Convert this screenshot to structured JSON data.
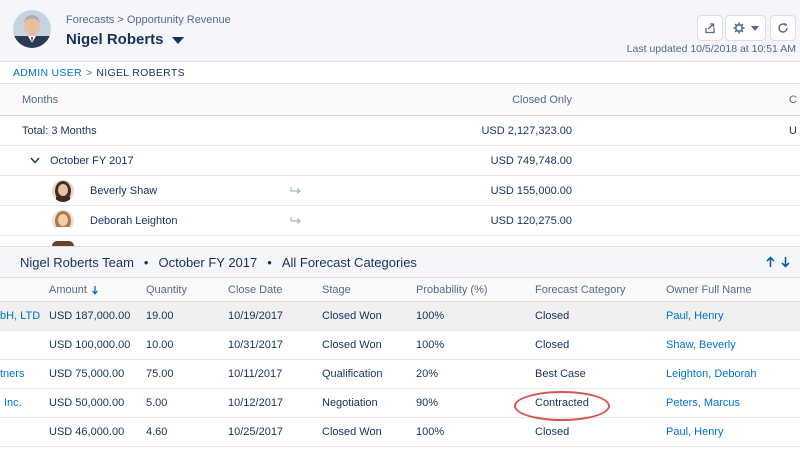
{
  "header": {
    "breadcrumb": "Forecasts > Opportunity Revenue",
    "owner_name": "Nigel Roberts",
    "last_updated": "Last updated 10/5/2018 at 10:51 AM",
    "share_icon": "share-icon",
    "gear_icon": "gear-icon",
    "refresh_icon": "refresh-icon"
  },
  "breadcrumb": {
    "parent": "ADMIN USER",
    "separator": ">",
    "current": "NIGEL ROBERTS"
  },
  "forecast_grid": {
    "columns": {
      "months": "Months",
      "closed_only": "Closed Only",
      "next_col_partial": "C"
    },
    "total_row": {
      "label": "Total: 3 Months",
      "closed_only": "USD 2,127,323.00",
      "next_col_partial": "U"
    },
    "period_row": {
      "label": "October FY 2017",
      "closed_only": "USD 749,748.00"
    },
    "reps": [
      {
        "name": "Beverly Shaw",
        "closed_only": "USD 155,000.00"
      },
      {
        "name": "Deborah Leighton",
        "closed_only": "USD 120,275.00"
      }
    ]
  },
  "panel": {
    "team": "Nigel Roberts Team",
    "period": "October FY 2017",
    "category": "All Forecast Categories",
    "separator": "•"
  },
  "opportunities": {
    "columns": {
      "amount": "Amount",
      "quantity": "Quantity",
      "close_date": "Close Date",
      "stage": "Stage",
      "probability": "Probability (%)",
      "forecast_category": "Forecast Category",
      "owner": "Owner Full Name"
    },
    "rows": [
      {
        "account": "bH, LTD",
        "amount": "USD 187,000.00",
        "quantity": "19.00",
        "close_date": "10/19/2017",
        "stage": "Closed Won",
        "probability": "100%",
        "forecast_category": "Closed",
        "owner": "Paul, Henry"
      },
      {
        "account": "",
        "amount": "USD 100,000.00",
        "quantity": "10.00",
        "close_date": "10/31/2017",
        "stage": "Closed Won",
        "probability": "100%",
        "forecast_category": "Closed",
        "owner": "Shaw, Beverly"
      },
      {
        "account": "tners",
        "amount": "USD 75,000.00",
        "quantity": "75.00",
        "close_date": "10/11/2017",
        "stage": "Qualification",
        "probability": "20%",
        "forecast_category": "Best Case",
        "owner": "Leighton, Deborah"
      },
      {
        "account": "Inc.",
        "amount": "USD 50,000.00",
        "quantity": "5.00",
        "close_date": "10/12/2017",
        "stage": "Negotiation",
        "probability": "90%",
        "forecast_category": "Contracted",
        "owner": "Peters, Marcus"
      },
      {
        "account": "",
        "amount": "USD 46,000.00",
        "quantity": "4.60",
        "close_date": "10/25/2017",
        "stage": "Closed Won",
        "probability": "100%",
        "forecast_category": "Closed",
        "owner": "Paul, Henry"
      }
    ]
  },
  "colors": {
    "link": "#0070d2",
    "text": "#16325c",
    "muted": "#54698d",
    "highlight": "#d9534f"
  }
}
